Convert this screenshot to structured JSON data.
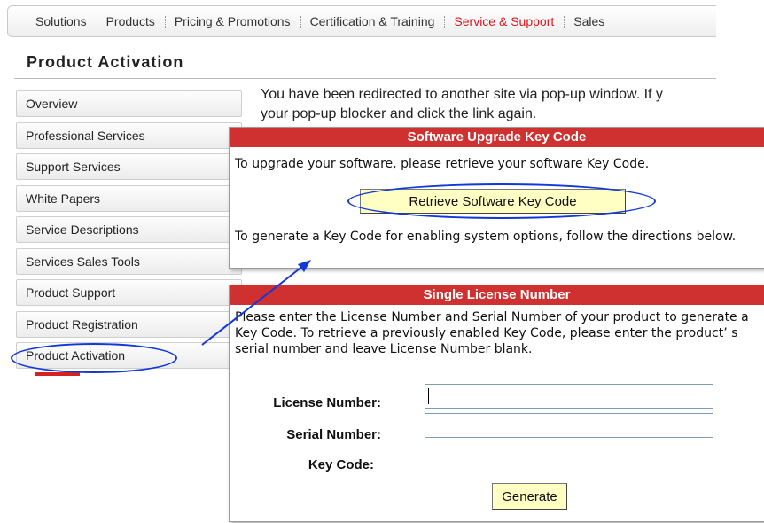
{
  "nav": {
    "items": [
      {
        "label": "Solutions"
      },
      {
        "label": "Products"
      },
      {
        "label": "Pricing & Promotions"
      },
      {
        "label": "Certification & Training"
      },
      {
        "label": "Service & Support",
        "active": true
      },
      {
        "label": "Sales"
      }
    ],
    "active_color": "#e0131a"
  },
  "page": {
    "title": "Product Activation",
    "message_line1": "You have been redirected to another site via pop-up window. If y",
    "message_line2": "your pop-up blocker and click the link again."
  },
  "sidebar": {
    "items": [
      {
        "label": "Overview"
      },
      {
        "label": "Professional Services"
      },
      {
        "label": "Support Services"
      },
      {
        "label": "White Papers"
      },
      {
        "label": "Service Descriptions"
      },
      {
        "label": "Services Sales Tools"
      },
      {
        "label": "Product Support"
      },
      {
        "label": "Product Registration"
      },
      {
        "label": "Product Activation",
        "highlighted": true
      }
    ]
  },
  "upgrade_panel": {
    "header": "Software Upgrade Key Code",
    "intro": "To upgrade your software, please retrieve your software Key Code.",
    "button_label": "Retrieve Software Key Code",
    "footer_text": "To generate a Key Code for enabling system options, follow the directions below."
  },
  "license_panel": {
    "header": "Single License Number",
    "instructions": "Please enter the License Number and Serial Number of your product to generate a Key Code. To retrieve a previously enabled Key Code, please enter the product’ s serial number and leave License Number blank.",
    "license_label": "License Number:",
    "license_value": "",
    "serial_label": "Serial Number:",
    "serial_value": "",
    "key_code_label": "Key Code:",
    "generate_label": "Generate"
  },
  "colors": {
    "header_red": "#cf3030",
    "button_yellow": "#ffffc4",
    "highlight_blue": "#1238d8"
  }
}
